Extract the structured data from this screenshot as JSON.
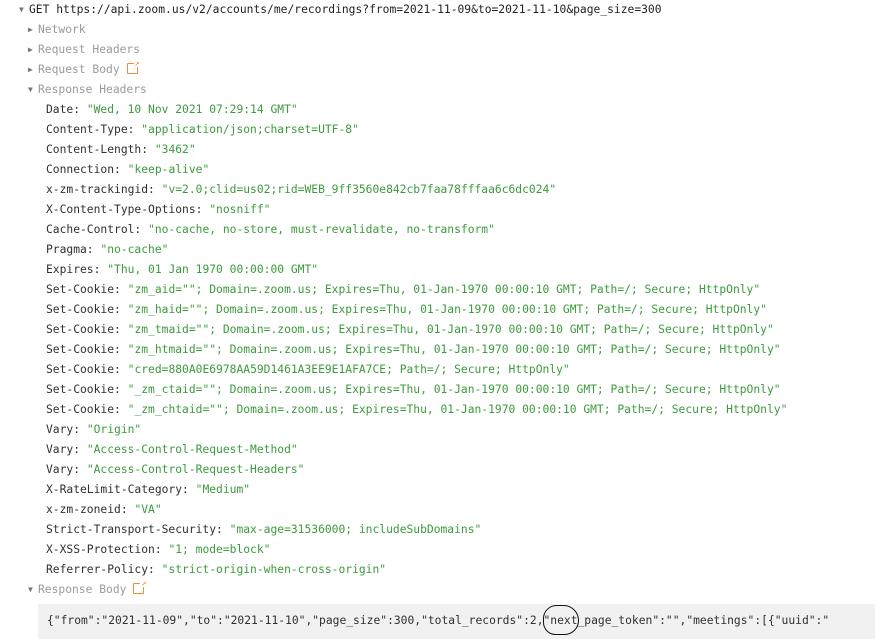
{
  "request": {
    "method": "GET",
    "url": "https://api.zoom.us/v2/accounts/me/recordings?from=2021-11-09&to=2021-11-10&page_size=300"
  },
  "sections": {
    "network": "Network",
    "request_headers": "Request Headers",
    "request_body": "Request Body",
    "response_headers": "Response Headers",
    "response_body": "Response Body"
  },
  "response_headers": [
    {
      "name": "Date:",
      "value": "\"Wed, 10 Nov 2021 07:29:14 GMT\""
    },
    {
      "name": "Content-Type:",
      "value": "\"application/json;charset=UTF-8\""
    },
    {
      "name": "Content-Length:",
      "value": "\"3462\""
    },
    {
      "name": "Connection:",
      "value": "\"keep-alive\""
    },
    {
      "name": "x-zm-trackingid:",
      "value": "\"v=2.0;clid=us02;rid=WEB_9ff3560e842cb7faa78fffaa6c6dc024\""
    },
    {
      "name": "X-Content-Type-Options:",
      "value": "\"nosniff\""
    },
    {
      "name": "Cache-Control:",
      "value": "\"no-cache, no-store, must-revalidate, no-transform\""
    },
    {
      "name": "Pragma:",
      "value": "\"no-cache\""
    },
    {
      "name": "Expires:",
      "value": "\"Thu, 01 Jan 1970 00:00:00 GMT\""
    },
    {
      "name": "Set-Cookie:",
      "value": "\"zm_aid=\"\"; Domain=.zoom.us; Expires=Thu, 01-Jan-1970 00:00:10 GMT; Path=/; Secure; HttpOnly\""
    },
    {
      "name": "Set-Cookie:",
      "value": "\"zm_haid=\"\"; Domain=.zoom.us; Expires=Thu, 01-Jan-1970 00:00:10 GMT; Path=/; Secure; HttpOnly\""
    },
    {
      "name": "Set-Cookie:",
      "value": "\"zm_tmaid=\"\"; Domain=.zoom.us; Expires=Thu, 01-Jan-1970 00:00:10 GMT; Path=/; Secure; HttpOnly\""
    },
    {
      "name": "Set-Cookie:",
      "value": "\"zm_htmaid=\"\"; Domain=.zoom.us; Expires=Thu, 01-Jan-1970 00:00:10 GMT; Path=/; Secure; HttpOnly\""
    },
    {
      "name": "Set-Cookie:",
      "value": "\"cred=880A0E6978AA59D1461A3EE9E1AFA7CE; Path=/; Secure; HttpOnly\""
    },
    {
      "name": "Set-Cookie:",
      "value": "\"_zm_ctaid=\"\"; Domain=.zoom.us; Expires=Thu, 01-Jan-1970 00:00:10 GMT; Path=/; Secure; HttpOnly\""
    },
    {
      "name": "Set-Cookie:",
      "value": "\"_zm_chtaid=\"\"; Domain=.zoom.us; Expires=Thu, 01-Jan-1970 00:00:10 GMT; Path=/; Secure; HttpOnly\""
    },
    {
      "name": "Vary:",
      "value": "\"Origin\""
    },
    {
      "name": "Vary:",
      "value": "\"Access-Control-Request-Method\""
    },
    {
      "name": "Vary:",
      "value": "\"Access-Control-Request-Headers\""
    },
    {
      "name": "X-RateLimit-Category:",
      "value": "\"Medium\""
    },
    {
      "name": "x-zm-zoneid:",
      "value": "\"VA\""
    },
    {
      "name": "Strict-Transport-Security:",
      "value": "\"max-age=31536000; includeSubDomains\""
    },
    {
      "name": "X-XSS-Protection:",
      "value": "\"1; mode=block\""
    },
    {
      "name": "Referrer-Policy:",
      "value": "\"strict-origin-when-cross-origin\""
    }
  ],
  "response_body": "{\"from\":\"2021-11-09\",\"to\":\"2021-11-10\",\"page_size\":300,\"total_records\":2,\"next_page_token\":\"\",\"meetings\":[{\"uuid\":\"",
  "colors": {
    "header_value": "#3c9b3c",
    "section_label": "#9a9a9a",
    "external_icon": "#f28c38",
    "body_background": "#f1f1f1"
  },
  "icons": {
    "expanded": "triangle-down-icon",
    "collapsed": "triangle-right-icon",
    "external": "external-link-icon"
  }
}
